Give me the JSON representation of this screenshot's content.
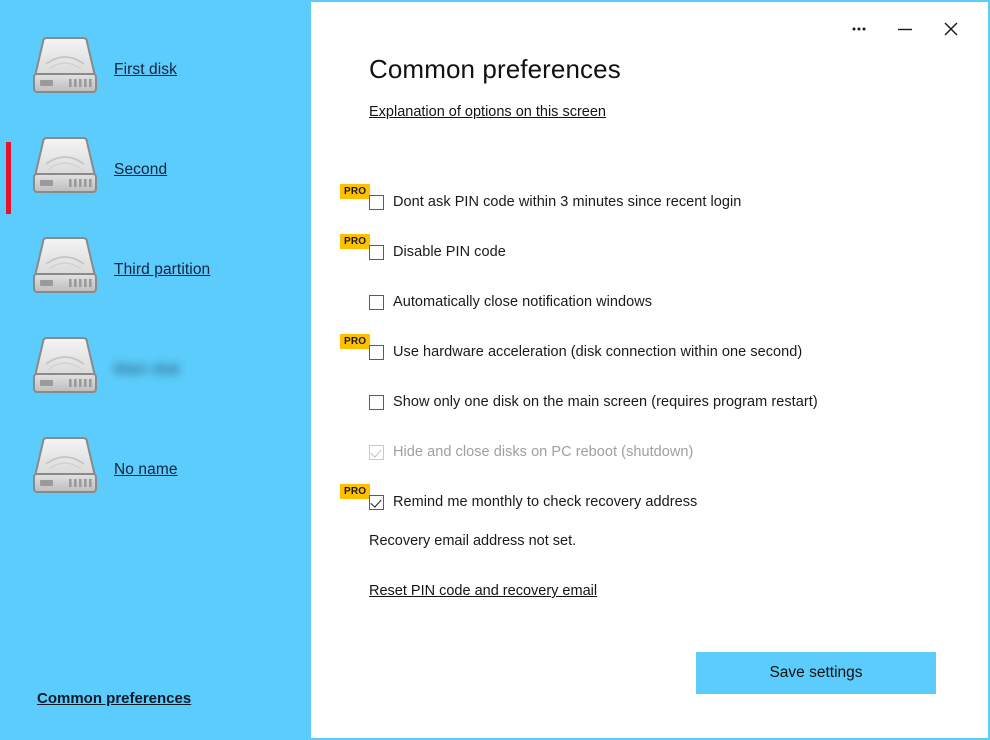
{
  "sidebar": {
    "disks": [
      {
        "label": "First disk",
        "selected": false,
        "blurred": false,
        "icon": "hard-disk-icon"
      },
      {
        "label": "Second",
        "selected": true,
        "blurred": false,
        "icon": "hard-disk-icon"
      },
      {
        "label": "Third partition",
        "selected": false,
        "blurred": false,
        "icon": "hard-disk-icon"
      },
      {
        "label": "Main disk",
        "selected": false,
        "blurred": true,
        "icon": "hard-disk-icon"
      },
      {
        "label": "No name",
        "selected": false,
        "blurred": false,
        "icon": "hard-disk-icon"
      }
    ],
    "footer_link": "Common preferences",
    "background_color": "#5BCCFB",
    "selection_color": "#E8112D"
  },
  "titlebar": {
    "more_icon": "ellipsis-icon",
    "minimize_icon": "minimize-icon",
    "close_icon": "close-icon"
  },
  "main": {
    "title": "Common preferences",
    "explanation_link": "Explanation of options on this screen",
    "options": [
      {
        "label": "Dont ask PIN code within 3 minutes since recent login",
        "pro": true,
        "pro_label": "PRO",
        "checked": false,
        "disabled": false
      },
      {
        "label": "Disable PIN code",
        "pro": true,
        "pro_label": "PRO",
        "checked": false,
        "disabled": false
      },
      {
        "label": "Automatically close notification windows",
        "pro": false,
        "pro_label": "",
        "checked": false,
        "disabled": false
      },
      {
        "label": "Use hardware acceleration (disk connection within one second)",
        "pro": true,
        "pro_label": "PRO",
        "checked": false,
        "disabled": false
      },
      {
        "label": "Show only one disk on the main screen (requires program restart)",
        "pro": false,
        "pro_label": "",
        "checked": false,
        "disabled": false
      },
      {
        "label": "Hide and close disks on PC reboot (shutdown)",
        "pro": false,
        "pro_label": "",
        "checked": true,
        "disabled": true
      },
      {
        "label": "Remind me monthly to check recovery address",
        "pro": true,
        "pro_label": "PRO",
        "checked": true,
        "disabled": false
      }
    ],
    "status_text": "Recovery email address not set.",
    "reset_link": "Reset PIN code and recovery email",
    "save_button": "Save settings",
    "accent_color": "#5BCCFB",
    "pro_badge_color": "#FFC000"
  }
}
